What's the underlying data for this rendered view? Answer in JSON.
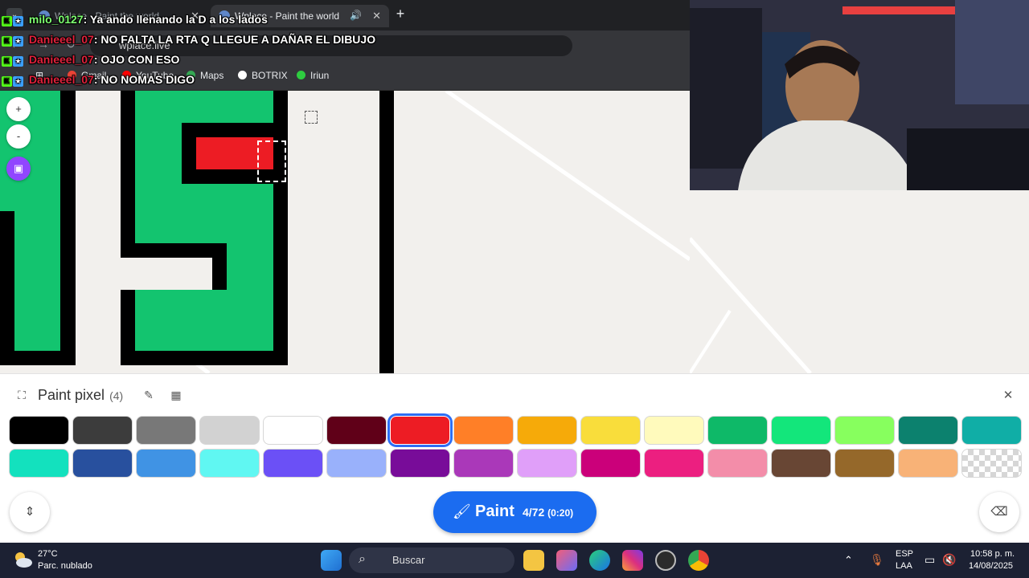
{
  "browser": {
    "tabs": [
      {
        "title": "Wplace - Paint the world",
        "active": false
      },
      {
        "title": "Wplace - Paint the world",
        "active": true
      }
    ],
    "url": "wplace.live",
    "bookmarks": [
      "Gmail",
      "YouTube",
      "Maps",
      "BOTRIX",
      "Iriun"
    ]
  },
  "chat": [
    {
      "user": "milo_0127",
      "user_color": "#7dff70",
      "message": ": Ya ando llenando la D a los lados"
    },
    {
      "user": "Danieeel_07",
      "user_color": "#e0213b",
      "message": ": NO FALTA LA RTA Q LLEGUE A DAÑAR EL DIBUJO"
    },
    {
      "user": "Danieeel_07",
      "user_color": "#e0213b",
      "message": ": OJO CON ESO"
    },
    {
      "user": "Danieeel_07",
      "user_color": "#e0213b",
      "message": ": NO NOMAS DIGO"
    }
  ],
  "map_controls": {
    "zoom_in": "+",
    "zoom_out": "-"
  },
  "panel": {
    "title": "Paint pixel",
    "count": "(4)",
    "palette": [
      {
        "color": "#000000"
      },
      {
        "color": "#3c3c3c"
      },
      {
        "color": "#787878"
      },
      {
        "color": "#d2d2d2"
      },
      {
        "color": "#ffffff"
      },
      {
        "color": "#600018"
      },
      {
        "color": "#ed1c24",
        "selected": true
      },
      {
        "color": "#ff7f27"
      },
      {
        "color": "#f6aa09"
      },
      {
        "color": "#f9dd3b"
      },
      {
        "color": "#fffabc"
      },
      {
        "color": "#0eb968"
      },
      {
        "color": "#13e67b"
      },
      {
        "color": "#87ff5e"
      },
      {
        "color": "#0c816e"
      },
      {
        "color": "#10aea6"
      },
      {
        "color": "#13e1be"
      },
      {
        "color": "#28509e"
      },
      {
        "color": "#4093e4"
      },
      {
        "color": "#60f7f2"
      },
      {
        "color": "#6b50f6"
      },
      {
        "color": "#99b1fb"
      },
      {
        "color": "#780c99"
      },
      {
        "color": "#aa38b9"
      },
      {
        "color": "#e09ff9"
      },
      {
        "color": "#cb007a"
      },
      {
        "color": "#ec1f80"
      },
      {
        "color": "#f38da9"
      },
      {
        "color": "#684634"
      },
      {
        "color": "#95682a"
      },
      {
        "color": "#f8b277"
      },
      {
        "color": "transparent"
      }
    ],
    "paint_button": {
      "label": "Paint",
      "count": "4/72",
      "timer": "(0:20)"
    }
  },
  "taskbar": {
    "temperature": "27°C",
    "weather": "Parc. nublado",
    "search_placeholder": "Buscar",
    "language": "ESP",
    "layout": "LAA",
    "time": "10:58 p. m.",
    "date": "14/08/2025"
  }
}
